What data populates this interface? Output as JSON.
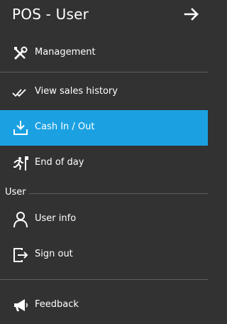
{
  "header": {
    "title": "POS - User"
  },
  "menu": {
    "management": "Management",
    "sales_history": "View sales history",
    "cash_in_out": "Cash In / Out",
    "end_of_day": "End of day",
    "section_user": "User",
    "user_info": "User info",
    "sign_out": "Sign out",
    "feedback": "Feedback"
  },
  "colors": {
    "background": "#323232",
    "active": "#1ba1e2",
    "divider": "#5e5e5e",
    "text": "#ffffff"
  }
}
